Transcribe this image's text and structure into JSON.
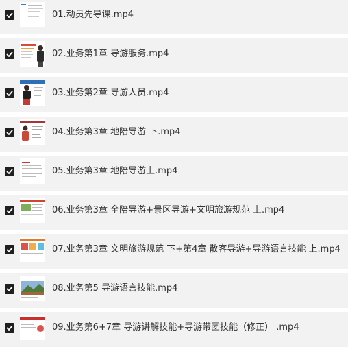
{
  "files": [
    {
      "name": "01.动员先导课.mp4",
      "checked": true,
      "thumbnail": "document-thumbnail"
    },
    {
      "name": "02.业务第1章 导游服务.mp4",
      "checked": true,
      "thumbnail": "slide-with-presenter-thumbnail"
    },
    {
      "name": "03.业务第2章 导游人员.mp4",
      "checked": true,
      "thumbnail": "slide-with-presenter-thumbnail"
    },
    {
      "name": "04.业务第3章 地陪导游 下.mp4",
      "checked": true,
      "thumbnail": "slide-with-presenter-thumbnail"
    },
    {
      "name": "05.业务第3章 地陪导游上.mp4",
      "checked": true,
      "thumbnail": "document-thumbnail"
    },
    {
      "name": "06.业务第3章 全陪导游+景区导游+文明旅游规范 上.mp4",
      "checked": true,
      "thumbnail": "slide-thumbnail"
    },
    {
      "name": "07.业务第3章 文明旅游规范 下+第4章 散客导游+导游语言技能 上.mp4",
      "checked": true,
      "thumbnail": "slide-thumbnail"
    },
    {
      "name": "08.业务第5 导游语言技能.mp4",
      "checked": true,
      "thumbnail": "landscape-slide-thumbnail"
    },
    {
      "name": "09.业务第6+7章 导游讲解技能+导游带团技能（修正） .mp4",
      "checked": true,
      "thumbnail": "slide-thumbnail"
    }
  ],
  "colors": {
    "row_background": "#f2f2f3",
    "checkbox": "#1f1f1f",
    "text": "#333333"
  }
}
